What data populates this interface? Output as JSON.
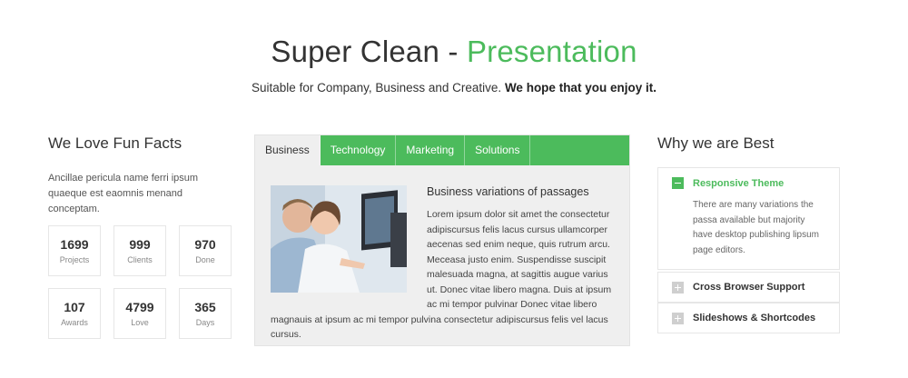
{
  "hero": {
    "title_main": "Super Clean - ",
    "title_accent": "Presentation",
    "subtitle_plain": "Suitable for Company, Business and Creative. ",
    "subtitle_bold": "We hope that you enjoy it."
  },
  "fun_facts": {
    "title": "We Love Fun Facts",
    "text": "Ancillae pericula name ferri ipsum quaeque est eaomnis menand conceptam.",
    "items": [
      {
        "value": "1699",
        "label": "Projects"
      },
      {
        "value": "999",
        "label": "Clients"
      },
      {
        "value": "970",
        "label": "Done"
      },
      {
        "value": "107",
        "label": "Awards"
      },
      {
        "value": "4799",
        "label": "Love"
      },
      {
        "value": "365",
        "label": "Days"
      }
    ]
  },
  "tabs": {
    "items": [
      "Business",
      "Technology",
      "Marketing",
      "Solutions"
    ],
    "active": "Business",
    "heading": "Business variations of passages",
    "text": "Lorem ipsum dolor sit amet the consectetur adipiscursus felis lacus cursus ullamcorper aecenas sed enim neque, quis rutrum arcu. Meceasa justo enim. Suspendisse suscipit malesuada magna, at sagittis augue varius ut. Donec vitae libero magna. Duis at ipsum ac mi tempor pulvinar Donec vitae libero magnauis at ipsum ac mi tempor pulvina consectetur adipiscursus felis vel lacus cursus."
  },
  "why_best": {
    "title": "Why we are Best",
    "items": [
      {
        "label": "Responsive Theme",
        "open": true,
        "body": "There are many variations the passa available but majority have desktop publishing lipsum page editors."
      },
      {
        "label": "Cross Browser Support",
        "open": false
      },
      {
        "label": "Slideshows & Shortcodes",
        "open": false
      }
    ]
  },
  "colors": {
    "accent": "#4cbb5c",
    "panel_bg": "#efefef"
  }
}
